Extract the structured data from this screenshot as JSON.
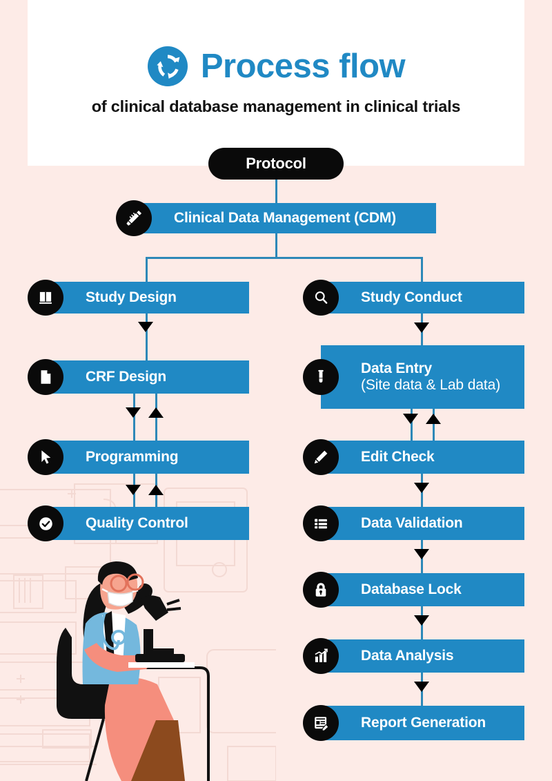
{
  "header": {
    "icon": "recycle-cycle-icon",
    "title": "Process flow",
    "subtitle": "of clinical database management in clinical trials",
    "title_color": "#2089c4",
    "panel_color": "#ffffff"
  },
  "theme": {
    "background": "#fdebe7",
    "accent_blue": "#2089c4",
    "connector_blue": "#2d88b8",
    "node_icon_bg": "#0a0a0a",
    "arrow_color": "#000000",
    "label_color": "#ffffff"
  },
  "root": {
    "label": "Protocol",
    "shape": "pill",
    "fill": "#0a0a0a"
  },
  "cdm": {
    "label": "Clinical Data Management (CDM)",
    "icon": "syringe-icon"
  },
  "branches": [
    {
      "name": "study-design-branch",
      "nodes": [
        {
          "label": "Study Design",
          "icon": "book-icon"
        },
        {
          "label": "CRF Design",
          "icon": "document-icon"
        },
        {
          "label": "Programming",
          "icon": "cursor-pointer-icon"
        },
        {
          "label": "Quality Control",
          "icon": "check-circle-icon"
        }
      ]
    },
    {
      "name": "study-conduct-branch",
      "nodes": [
        {
          "label": "Study Conduct",
          "icon": "magnifier-icon"
        },
        {
          "label": "Data Entry",
          "sublabel": "(Site data & Lab data)",
          "icon": "test-tube-icon"
        },
        {
          "label": "Edit Check",
          "icon": "pencil-icon"
        },
        {
          "label": "Data Validation",
          "icon": "list-icon"
        },
        {
          "label": "Database Lock",
          "icon": "padlock-icon"
        },
        {
          "label": "Data Analysis",
          "icon": "bar-chart-icon"
        },
        {
          "label": "Report Generation",
          "icon": "report-pencil-icon"
        }
      ]
    }
  ],
  "illustration": {
    "name": "scientist-at-microscope",
    "description": "Masked scientist in blue scrubs seated on stool using a microscope, faint lab shelving outline behind"
  }
}
